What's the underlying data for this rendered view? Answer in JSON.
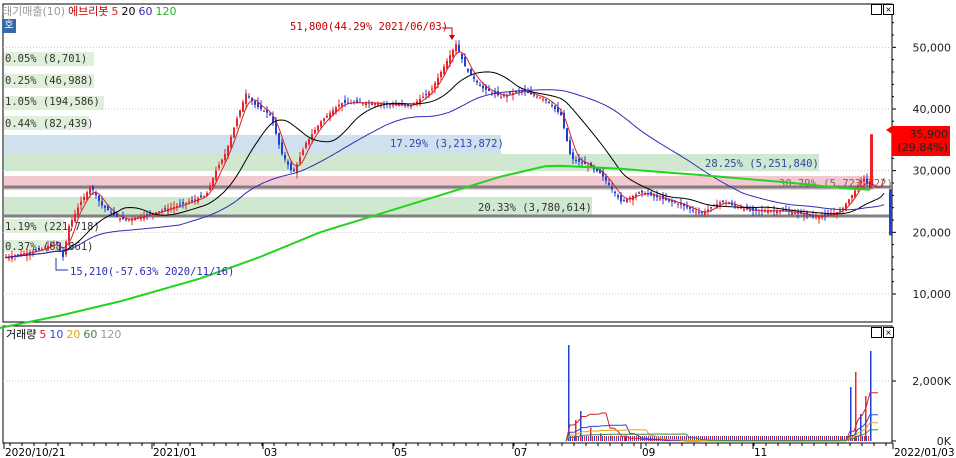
{
  "legend_price": {
    "badge": "호",
    "name": "태기매출(10)",
    "stock": "에브리봇",
    "ma5": "5",
    "ma20": "20",
    "ma60": "60",
    "ma120": "120"
  },
  "legend_volume": {
    "name": "거래량",
    "ma5": "5",
    "ma10": "10",
    "ma20": "20",
    "ma60": "60",
    "ma120": "120"
  },
  "colors": {
    "up": "#e8262a",
    "down": "#1f3fd6",
    "ma5": "#d3212d",
    "ma20": "#000000",
    "ma60": "#2d2db8",
    "ma120": "#22d41e",
    "ma10_vol": "#2d49d6",
    "ma20_vol": "#e3a21a",
    "ma60_vol": "#3a8a3a",
    "ma120_vol": "#9a9a9a"
  },
  "chart_data": [
    {
      "type": "candlestick",
      "title": "에브리봇",
      "ylim": [
        0,
        60000
      ],
      "y_ticks": [
        "50,000",
        "40,000",
        "30,000",
        "20,000",
        "10,000"
      ],
      "x_ticks": [
        "2020/10/21",
        "2021/01",
        "03",
        "05",
        "07",
        "09",
        "11",
        "2022/01/03"
      ],
      "last_price": "35,900",
      "last_change": "(29.84%)",
      "annotations": {
        "high": "51,800(44.29% 2021/06/03)",
        "low": "15,210(-57.63% 2020/11/16)"
      },
      "volume_profile": [
        {
          "label": "0.05% (8,701)"
        },
        {
          "label": "0.25% (46,988)"
        },
        {
          "label": "1.05% (194,586)"
        },
        {
          "label": "0.44% (82,439)"
        },
        {
          "label": "17.29% (3,213,872)"
        },
        {
          "label": "28.25% (5,251,840)"
        },
        {
          "label": "30.79% (5,723,722)"
        },
        {
          "label": "20.33% (3,780,614)"
        },
        {
          "label": "1.19% (221,718)"
        },
        {
          "label": "0.37% (68,861)"
        }
      ],
      "moving_averages": [
        "5",
        "20",
        "60",
        "120"
      ],
      "price_path": [
        [
          0,
          15800
        ],
        [
          20,
          16500
        ],
        [
          40,
          17200
        ],
        [
          55,
          18500
        ],
        [
          62,
          16000
        ],
        [
          68,
          21000
        ],
        [
          80,
          25000
        ],
        [
          90,
          27500
        ],
        [
          100,
          24500
        ],
        [
          115,
          22500
        ],
        [
          125,
          22000
        ],
        [
          150,
          23000
        ],
        [
          180,
          24500
        ],
        [
          205,
          26000
        ],
        [
          215,
          30000
        ],
        [
          225,
          33000
        ],
        [
          235,
          38000
        ],
        [
          245,
          42500
        ],
        [
          255,
          40500
        ],
        [
          270,
          39000
        ],
        [
          280,
          33000
        ],
        [
          292,
          29500
        ],
        [
          305,
          34500
        ],
        [
          320,
          38000
        ],
        [
          340,
          41000
        ],
        [
          370,
          41000
        ],
        [
          410,
          40500
        ],
        [
          430,
          43000
        ],
        [
          440,
          46000
        ],
        [
          455,
          50500
        ],
        [
          465,
          46500
        ],
        [
          480,
          43500
        ],
        [
          500,
          42000
        ],
        [
          520,
          43000
        ],
        [
          545,
          41500
        ],
        [
          560,
          39000
        ],
        [
          570,
          32000
        ],
        [
          585,
          31000
        ],
        [
          600,
          29500
        ],
        [
          620,
          25000
        ],
        [
          640,
          26500
        ],
        [
          660,
          25500
        ],
        [
          680,
          24500
        ],
        [
          700,
          23000
        ],
        [
          720,
          25000
        ],
        [
          750,
          23500
        ],
        [
          780,
          23500
        ],
        [
          800,
          23000
        ],
        [
          820,
          22500
        ],
        [
          840,
          23500
        ],
        [
          855,
          27000
        ],
        [
          862,
          29000
        ],
        [
          870,
          27000
        ],
        [
          880,
          27000
        ],
        [
          885,
          35900
        ]
      ]
    },
    {
      "type": "bar",
      "title": "거래량",
      "ylim": [
        0,
        3200000
      ],
      "y_ticks": [
        "2,000K",
        "0K"
      ],
      "spikes": [
        [
          568,
          3200000
        ],
        [
          575,
          700000
        ],
        [
          580,
          1000000
        ],
        [
          590,
          450000
        ],
        [
          600,
          250000
        ],
        [
          610,
          180000
        ],
        [
          625,
          130000
        ],
        [
          650,
          90000
        ],
        [
          700,
          70000
        ],
        [
          760,
          60000
        ],
        [
          800,
          60000
        ],
        [
          840,
          150000
        ],
        [
          850,
          1800000
        ],
        [
          855,
          2300000
        ],
        [
          860,
          900000
        ],
        [
          865,
          1500000
        ],
        [
          870,
          3000000
        ]
      ]
    }
  ]
}
